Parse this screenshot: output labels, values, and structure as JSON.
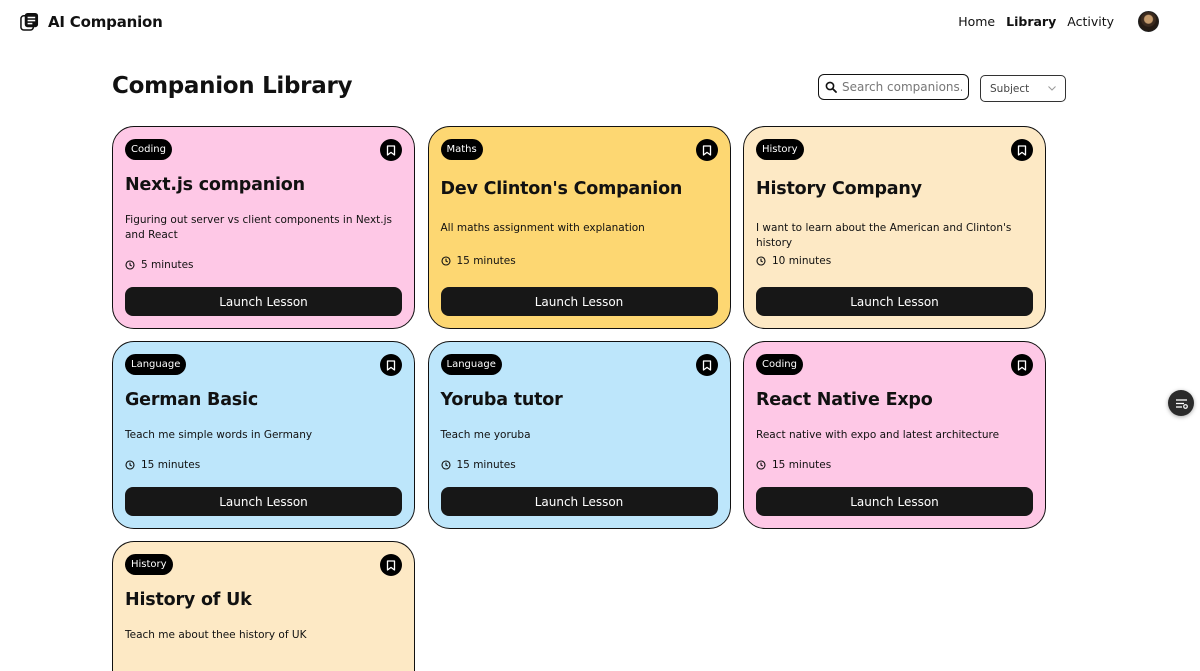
{
  "app": {
    "name": "AI Companion"
  },
  "nav": {
    "items": [
      "Home",
      "Library",
      "Activity"
    ],
    "active": "Library"
  },
  "page": {
    "title": "Companion Library"
  },
  "filters": {
    "search_placeholder": "Search companions...",
    "subject_label": "Subject"
  },
  "colors": {
    "pink": "#fec8e6",
    "yellow": "#fdd772",
    "peach": "#fde9c5",
    "blue": "#bde6fb"
  },
  "cards": [
    {
      "subject": "Coding",
      "title": "Next.js companion",
      "description": "Figuring out server vs client components in Next.js and React",
      "duration": "5 minutes",
      "button": "Launch Lesson",
      "color": "#fec8e6"
    },
    {
      "subject": "Maths",
      "title": "Dev Clinton's Companion",
      "description": "All maths assignment with explanation",
      "duration": "15 minutes",
      "button": "Launch Lesson",
      "color": "#fdd772"
    },
    {
      "subject": "History",
      "title": "History Company",
      "description": "I want to learn about the American and Clinton's history",
      "duration": "10 minutes",
      "button": "Launch Lesson",
      "color": "#fde9c5"
    },
    {
      "subject": "Language",
      "title": "German Basic",
      "description": "Teach me simple words in Germany",
      "duration": "15 minutes",
      "button": "Launch Lesson",
      "color": "#bde6fb"
    },
    {
      "subject": "Language",
      "title": "Yoruba tutor",
      "description": "Teach me yoruba",
      "duration": "15 minutes",
      "button": "Launch Lesson",
      "color": "#bde6fb"
    },
    {
      "subject": "Coding",
      "title": "React Native Expo",
      "description": "React native with expo and latest architecture",
      "duration": "15 minutes",
      "button": "Launch Lesson",
      "color": "#fec8e6"
    },
    {
      "subject": "History",
      "title": "History of Uk",
      "description": "Teach me about thee history of UK",
      "duration": "",
      "button": "",
      "color": "#fde9c5"
    }
  ]
}
